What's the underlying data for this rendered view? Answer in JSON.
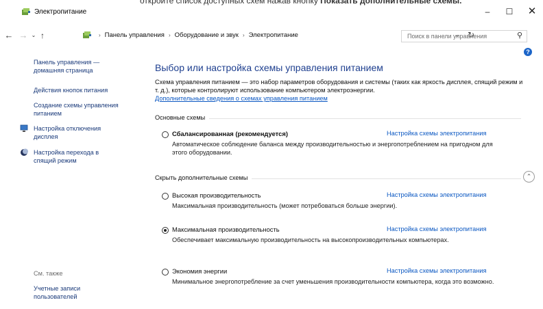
{
  "top_caption": {
    "prefix": "откройте список доступных схем нажав кнопку ",
    "bold": "Показать дополнительные схемы."
  },
  "window": {
    "title": "Электропитание",
    "buttons": {
      "minimize": "–",
      "maximize": "☐",
      "close": "✕"
    }
  },
  "address_bar": {
    "back": "←",
    "forward": "→",
    "recent": "⌄",
    "up": "↑",
    "breadcrumbs": [
      "Панель управления",
      "Оборудование и звук",
      "Электропитание"
    ],
    "separator": "›",
    "dropdown": "⌄",
    "refresh": "↻"
  },
  "search": {
    "placeholder": "Поиск в панели управления",
    "icon": "⚲"
  },
  "help_label": "?",
  "sidebar": {
    "items": [
      {
        "label": "Панель управления —\nдомашняя страница",
        "icon": null
      },
      {
        "label": "Действия кнопок питания",
        "icon": null
      },
      {
        "label": "Создание схемы управления\nпитанием",
        "icon": null
      },
      {
        "label": "Настройка отключения\nдисплея",
        "icon": "monitor-icon"
      },
      {
        "label": "Настройка перехода в\nспящий режим",
        "icon": "moon-icon"
      }
    ],
    "see_also": "См. также",
    "see_also_items": [
      {
        "label": "Учетные записи\nпользователей"
      }
    ]
  },
  "main": {
    "title": "Выбор или настройка схемы управления питанием",
    "intro": "Схема управления питанием — это набор параметров оборудования и системы (таких как яркость дисплея, спящий режим и т. д.), которые контролируют использование компьютером электроэнергии.",
    "intro_link": "Дополнительные сведения о схемах управления питанием",
    "primary_header": "Основные схемы",
    "hidden_header": "Скрыть дополнительные схемы",
    "collapse_symbol": "⌃",
    "settings_link": "Настройка схемы электропитания",
    "plans": [
      {
        "name": "Сбалансированная (рекомендуется)",
        "description": "Автоматическое соблюдение баланса между производительностью и энергопотреблением на пригодном для этого оборудовании.",
        "selected": false,
        "bold": true
      },
      {
        "name": "Высокая производительность",
        "description": "Максимальная производительность (может потребоваться больше энергии).",
        "selected": false,
        "bold": false
      },
      {
        "name": "Максимальная производительность",
        "description": "Обеспечивает максимальную производительность на высокопроизводительных компьютерах.",
        "selected": true,
        "bold": false
      },
      {
        "name": "Экономия энергии",
        "description": "Минимальное энергопотребление за счет уменьшения производительности компьютера, когда это возможно.",
        "selected": false,
        "bold": false
      }
    ]
  }
}
